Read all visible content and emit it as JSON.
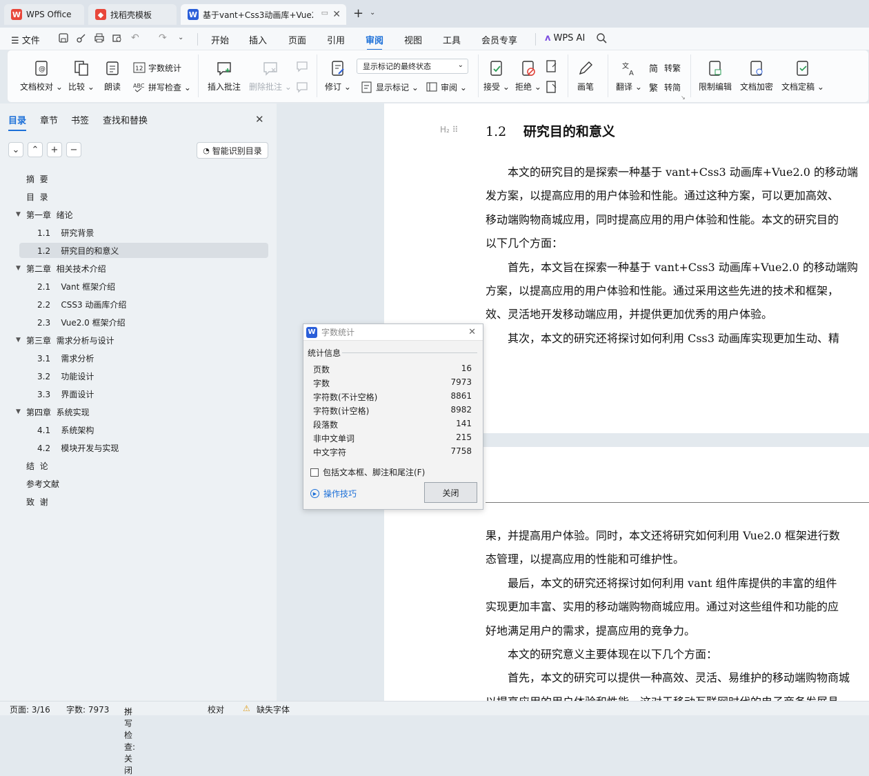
{
  "tabs": [
    {
      "label": "WPS Office"
    },
    {
      "label": "找稻壳模板"
    },
    {
      "label": "基于vant+Css3动画库+Vue2.0"
    }
  ],
  "menu": {
    "file": "文件",
    "items": [
      "开始",
      "插入",
      "页面",
      "引用",
      "审阅",
      "视图",
      "工具",
      "会员专享"
    ],
    "active": "审阅",
    "ai": "WPS AI"
  },
  "ribbon": {
    "doc_proofread": "文档校对",
    "compare": "比较",
    "read_aloud": "朗读",
    "word_count": "字数统计",
    "spell_check": "拼写检查",
    "insert_comment": "插入批注",
    "delete_comment": "删除批注",
    "track_changes": "修订",
    "markup_state": "显示标记的最终状态",
    "show_markup": "显示标记",
    "review": "审阅",
    "accept": "接受",
    "reject": "拒绝",
    "pen": "画笔",
    "translate": "翻译",
    "to_traditional": "转繁",
    "to_simplified": "转简",
    "restrict_edit": "限制编辑",
    "encrypt": "文档加密",
    "finalize": "文档定稿"
  },
  "nav": {
    "tabs": [
      "目录",
      "章节",
      "书签",
      "查找和替换"
    ],
    "smart_btn": "智能识别目录",
    "toc": [
      {
        "label": "摘  要",
        "level": 0
      },
      {
        "label": "目  录",
        "level": 0
      },
      {
        "label": "第一章  绪论",
        "level": 0,
        "expanded": true
      },
      {
        "label": "1.1    研究背景",
        "level": 1
      },
      {
        "label": "1.2    研究目的和意义",
        "level": 1,
        "selected": true
      },
      {
        "label": "第二章  相关技术介绍",
        "level": 0,
        "expanded": true
      },
      {
        "label": "2.1    Vant 框架介绍",
        "level": 1
      },
      {
        "label": "2.2    CSS3 动画库介绍",
        "level": 1
      },
      {
        "label": "2.3    Vue2.0 框架介绍",
        "level": 1
      },
      {
        "label": "第三章  需求分析与设计",
        "level": 0,
        "expanded": true
      },
      {
        "label": "3.1    需求分析",
        "level": 1
      },
      {
        "label": "3.2    功能设计",
        "level": 1
      },
      {
        "label": "3.3    界面设计",
        "level": 1
      },
      {
        "label": "第四章  系统实现",
        "level": 0,
        "expanded": true
      },
      {
        "label": "4.1    系统架构",
        "level": 1
      },
      {
        "label": "4.2    模块开发与实现",
        "level": 1
      },
      {
        "label": "结  论",
        "level": 0
      },
      {
        "label": "参考文献",
        "level": 0
      },
      {
        "label": "致  谢",
        "level": 0
      }
    ]
  },
  "doc": {
    "heading_num": "1.2",
    "heading_text": "研究目的和意义",
    "page1_lines": [
      "　　本文的研究目的是探索一种基于 vant+Css3 动画库+Vue2.0 的移动端",
      "发方案，以提高应用的用户体验和性能。通过这种方案，可以更加高效、",
      "移动端购物商城应用，同时提高应用的用户体验和性能。本文的研究目的",
      "以下几个方面：",
      "　　首先，本文旨在探索一种基于 vant+Css3 动画库+Vue2.0 的移动端购",
      "方案，以提高应用的用户体验和性能。通过采用这些先进的技术和框架，",
      "效、灵活地开发移动端应用，并提供更加优秀的用户体验。",
      "　　其次，本文的研究还将探讨如何利用 Css3 动画库实现更加生动、精"
    ],
    "page2_lines": [
      "果，并提高用户体验。同时，本文还将研究如何利用 Vue2.0 框架进行数",
      "态管理，以提高应用的性能和可维护性。",
      "　　最后，本文的研究还将探讨如何利用 vant 组件库提供的丰富的组件",
      "实现更加丰富、实用的移动端购物商城应用。通过对这些组件和功能的应",
      "好地满足用户的需求，提高应用的竞争力。",
      "　　本文的研究意义主要体现在以下几个方面：",
      "　　首先，本文的研究可以提供一种高效、灵活、易维护的移动端购物商城",
      "以提高应用的用户体验和性能。这对于移动互联网时代的电子商务发展具"
    ]
  },
  "dialog": {
    "title": "字数统计",
    "section": "统计信息",
    "stats": [
      {
        "label": "页数",
        "value": "16"
      },
      {
        "label": "字数",
        "value": "7973"
      },
      {
        "label": "字符数(不计空格)",
        "value": "8861"
      },
      {
        "label": "字符数(计空格)",
        "value": "8982"
      },
      {
        "label": "段落数",
        "value": "141"
      },
      {
        "label": "非中文单词",
        "value": "215"
      },
      {
        "label": "中文字符",
        "value": "7758"
      }
    ],
    "checkbox": "包括文本框、脚注和尾注(F)",
    "tips": "操作技巧",
    "close": "关闭"
  },
  "status": {
    "page": "页面: 3/16",
    "words": "字数: 7973",
    "spell": "拼写检查: 关闭",
    "proof": "校对",
    "missing_font": "缺失字体"
  },
  "colors": {
    "accent": "#1b6fd8",
    "wps_red": "#e8473b",
    "doc_blue": "#2b5fd9"
  }
}
